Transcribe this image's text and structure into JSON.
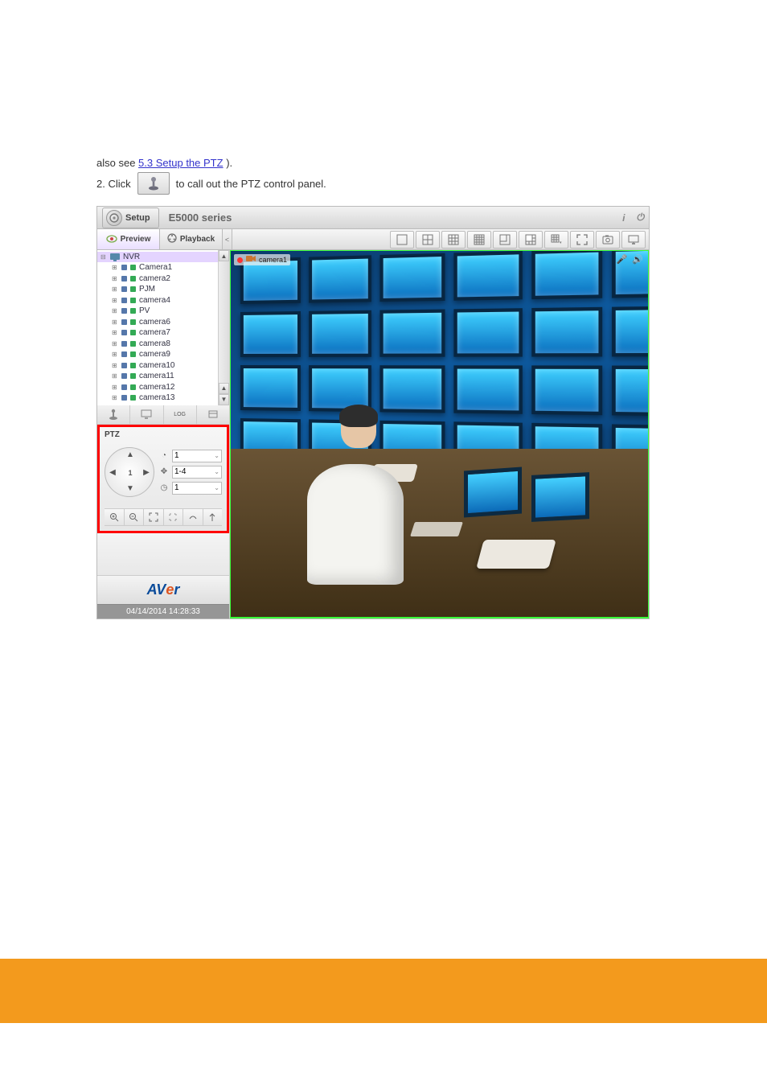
{
  "doc": {
    "line1_prefix": "also see ",
    "line1_link": "5.3 Setup the PTZ",
    "line1_suffix": ").",
    "line2_before": "2. Click ",
    "line2_after": " to call out the PTZ control panel."
  },
  "titlebar": {
    "setup": "Setup",
    "series": "E5000 series"
  },
  "tabs": {
    "preview": "Preview",
    "playback": "Playback"
  },
  "tree": {
    "root": "NVR",
    "items": [
      "Camera1",
      "camera2",
      "PJM",
      "camera4",
      "PV",
      "camera6",
      "camera7",
      "camera8",
      "camera9",
      "camera10",
      "camera11",
      "camera12",
      "camera13"
    ]
  },
  "below_tree_btns": {
    "b3": "LOG"
  },
  "ptz": {
    "title": "PTZ",
    "center": "1",
    "drop1": "1",
    "drop2": "1-4",
    "drop3": "1"
  },
  "brand": {
    "a": "AV",
    "e": "e",
    "r": "r"
  },
  "timestamp": "04/14/2014 14:28:33",
  "video_status": {
    "label": "camera1"
  }
}
